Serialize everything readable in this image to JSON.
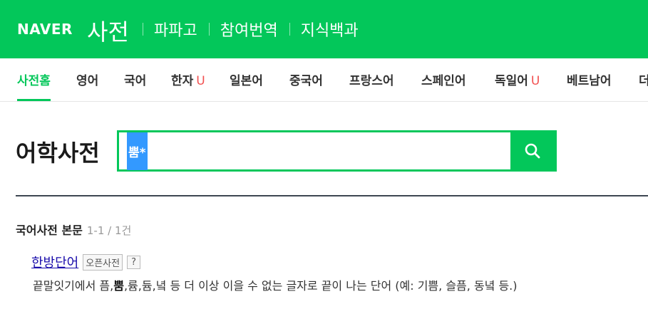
{
  "header": {
    "logo": "NAVER",
    "service_title": "사전",
    "nav": [
      "파파고",
      "참여번역",
      "지식백과"
    ]
  },
  "tabs": [
    {
      "label": "사전홈",
      "active": true,
      "badge": ""
    },
    {
      "label": "영어",
      "active": false,
      "badge": ""
    },
    {
      "label": "국어",
      "active": false,
      "badge": ""
    },
    {
      "label": "한자",
      "active": false,
      "badge": "U"
    },
    {
      "label": "일본어",
      "active": false,
      "badge": ""
    },
    {
      "label": "중국어",
      "active": false,
      "badge": ""
    },
    {
      "label": "프랑스어",
      "active": false,
      "badge": ""
    },
    {
      "label": "스페인어",
      "active": false,
      "badge": ""
    },
    {
      "label": "독일어",
      "active": false,
      "badge": "U"
    },
    {
      "label": "베트남어",
      "active": false,
      "badge": ""
    },
    {
      "label": "더",
      "active": false,
      "badge": ""
    }
  ],
  "page": {
    "heading": "어학사전"
  },
  "search": {
    "value": "뿜*"
  },
  "results": {
    "section_title": "국어사전 본문",
    "count": "1-1 / 1건",
    "entries": [
      {
        "word": "한방단어",
        "tag": "오픈사전",
        "help": "?",
        "def_before": "끝말잇기에서 픔,",
        "def_bold": "뿜",
        "def_after": ",륨,듐,녘 등 더 이상 이을 수 없는 글자로 끝이 나는 단어 (예: 기쁨, 슬픔, 동녘 등.)"
      }
    ]
  },
  "colors": {
    "brand": "#03c75a",
    "badge": "#f25050",
    "link": "#1a0dab",
    "selection": "#3399ff"
  }
}
